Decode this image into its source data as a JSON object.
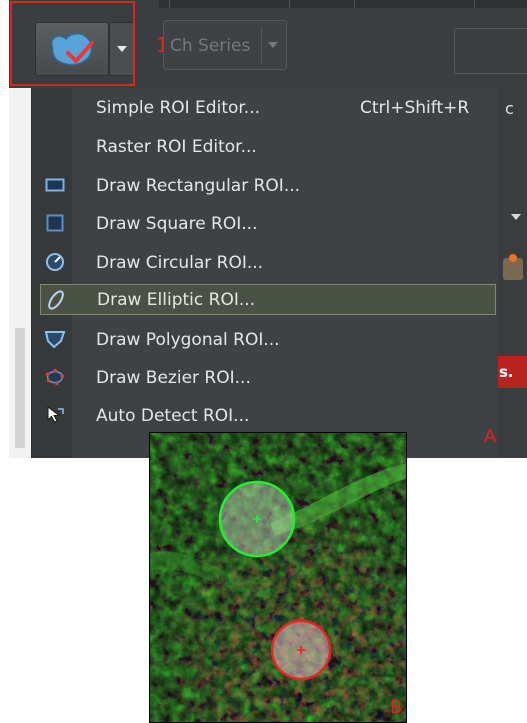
{
  "toolbar": {
    "roi_button_icon": "roi-shape-checkmark-icon",
    "dropdown_icon": "chevron-down-icon",
    "annotation_1": "1",
    "channel_series": "Ch Series"
  },
  "menu": {
    "items": [
      {
        "label": "Simple ROI Editor...",
        "shortcut": "Ctrl+Shift+R",
        "icon": ""
      },
      {
        "label": "Raster ROI Editor...",
        "shortcut": "",
        "icon": ""
      },
      {
        "label": "Draw Rectangular ROI...",
        "shortcut": "",
        "icon": "rectangle-roi-icon"
      },
      {
        "label": "Draw Square ROI...",
        "shortcut": "",
        "icon": "square-roi-icon"
      },
      {
        "label": "Draw Circular ROI...",
        "shortcut": "",
        "icon": "circle-roi-icon"
      },
      {
        "label": "Draw Elliptic ROI...",
        "shortcut": "",
        "icon": "ellipse-roi-icon",
        "selected": true
      },
      {
        "label": "Draw Polygonal ROI...",
        "shortcut": "",
        "icon": "polygon-roi-icon"
      },
      {
        "label": "Draw Bezier ROI...",
        "shortcut": "",
        "icon": "bezier-roi-icon"
      },
      {
        "label": "Auto Detect ROI...",
        "shortcut": "",
        "icon": "auto-detect-cursor-icon"
      }
    ]
  },
  "side": {
    "c_label": "c",
    "s_label": "s."
  },
  "panels": {
    "label_a": "A",
    "label_b": "B"
  },
  "colors": {
    "annotation_red": "#e2231a",
    "roi_green": "#22dd33",
    "roi_red": "#ee2222",
    "menu_bg": "#3f4244",
    "selected_bg": "#4a5245"
  },
  "image": {
    "rois": [
      {
        "color": "green",
        "shape": "circle"
      },
      {
        "color": "red",
        "shape": "circle"
      }
    ]
  }
}
